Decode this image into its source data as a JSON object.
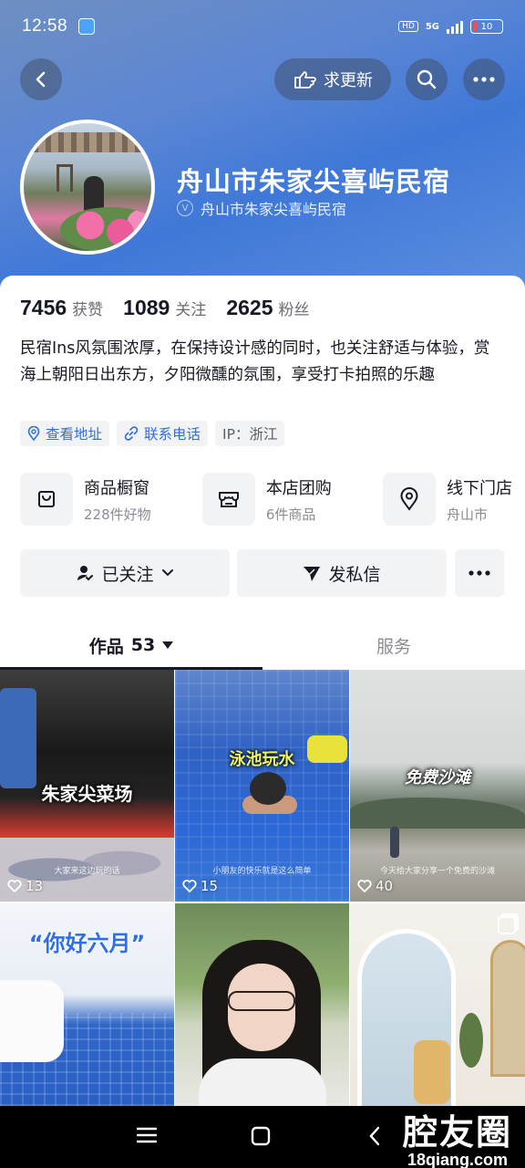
{
  "status_bar": {
    "time": "12:58",
    "network": "5G",
    "hd_label": "HD",
    "battery": "10"
  },
  "header": {
    "back_icon": "chevron-left-icon",
    "request_update_label": "求更新",
    "search_icon": "search-icon",
    "more_icon": "more-horizontal-icon"
  },
  "profile": {
    "name": "舟山市朱家尖喜屿民宿",
    "verified_name": "舟山市朱家尖喜屿民宿",
    "stats": [
      {
        "value": "7456",
        "label": "获赞"
      },
      {
        "value": "1089",
        "label": "关注"
      },
      {
        "value": "2625",
        "label": "粉丝"
      }
    ],
    "bio": "民宿Ins风氛围浓厚，在保持设计感的同时，也关注舒适与体验，赏海上朝阳日出东方，夕阳微醺的氛围，享受打卡拍照的乐趣",
    "tags": {
      "address": "查看地址",
      "phone": "联系电话",
      "ip": "IP：浙江"
    }
  },
  "entries": [
    {
      "title": "商品橱窗",
      "sub": "228件好物",
      "icon": "shop-bag-icon"
    },
    {
      "title": "本店团购",
      "sub": "6件商品",
      "icon": "group-buy-icon"
    },
    {
      "title": "线下门店",
      "sub": "舟山市",
      "icon": "location-pin-icon"
    }
  ],
  "actions": {
    "followed_label": "已关注",
    "message_label": "发私信"
  },
  "tabs": {
    "works_label": "作品",
    "works_count": "53",
    "service_label": "服务"
  },
  "works": [
    {
      "caption": "朱家尖菜场",
      "sub": "大家来这边玩的话",
      "likes": "13"
    },
    {
      "caption": "泳池玩水",
      "sub": "小朋友的快乐就是这么简单",
      "likes": "15"
    },
    {
      "caption": "免费沙滩",
      "sub": "今天给大家分享一个免费的沙滩",
      "likes": "40"
    },
    {
      "caption": "“你好六月”",
      "sub": "",
      "likes": ""
    },
    {
      "caption": "",
      "sub": "",
      "likes": ""
    },
    {
      "caption": "",
      "sub": "",
      "likes": ""
    }
  ],
  "watermark": {
    "main": "腔友圈",
    "sub": "18qiang.com"
  }
}
